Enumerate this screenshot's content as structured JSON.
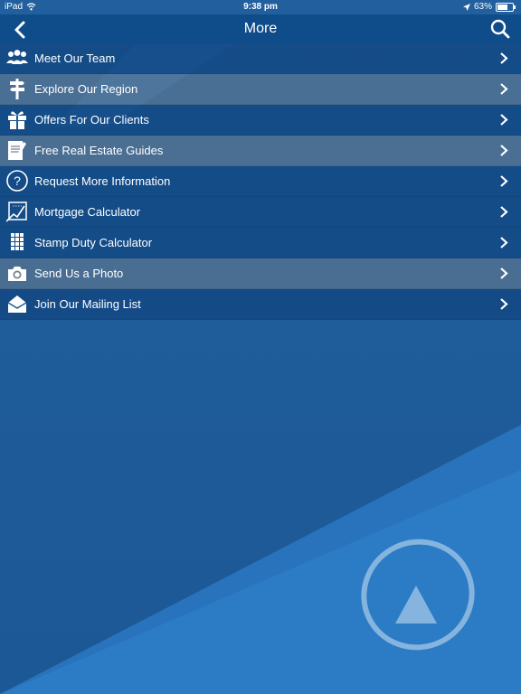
{
  "status_bar": {
    "device": "iPad",
    "time": "9:38 pm",
    "battery": "63%",
    "battery_fraction": 0.63
  },
  "nav": {
    "title": "More",
    "back_icon": "chevron-left-icon",
    "search_icon": "search-icon"
  },
  "menu": {
    "items": [
      {
        "label": "Meet Our Team",
        "icon": "team-icon"
      },
      {
        "label": "Explore Our Region",
        "icon": "signpost-icon"
      },
      {
        "label": "Offers For Our Clients",
        "icon": "gift-icon"
      },
      {
        "label": "Free Real Estate Guides",
        "icon": "document-icon"
      },
      {
        "label": "Request More Information",
        "icon": "question-icon"
      },
      {
        "label": "Mortgage Calculator",
        "icon": "chart-icon"
      },
      {
        "label": "Stamp Duty Calculator",
        "icon": "calculator-icon"
      },
      {
        "label": "Send Us a Photo",
        "icon": "camera-icon"
      },
      {
        "label": "Join Our Mailing List",
        "icon": "envelope-icon"
      }
    ]
  },
  "colors": {
    "nav_bg": "#0e4c8a",
    "background": "#1f5c9a",
    "accent_light": "#2a7bc6"
  }
}
